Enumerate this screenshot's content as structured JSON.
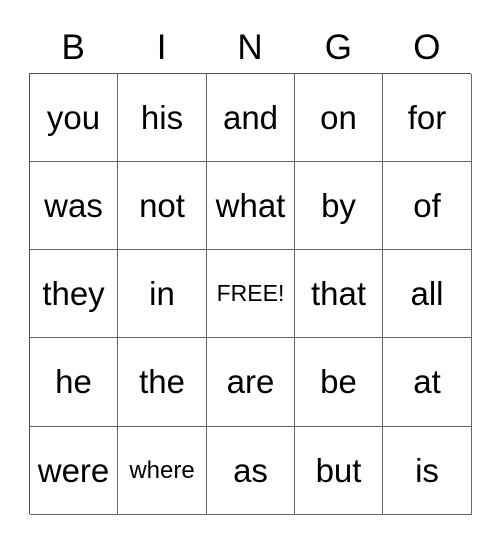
{
  "header": [
    "B",
    "I",
    "N",
    "G",
    "O"
  ],
  "rows": [
    [
      "you",
      "his",
      "and",
      "on",
      "for"
    ],
    [
      "was",
      "not",
      "what",
      "by",
      "of"
    ],
    [
      "they",
      "in",
      "FREE!",
      "that",
      "all"
    ],
    [
      "he",
      "the",
      "are",
      "be",
      "at"
    ],
    [
      "were",
      "where",
      "as",
      "but",
      "is"
    ]
  ]
}
